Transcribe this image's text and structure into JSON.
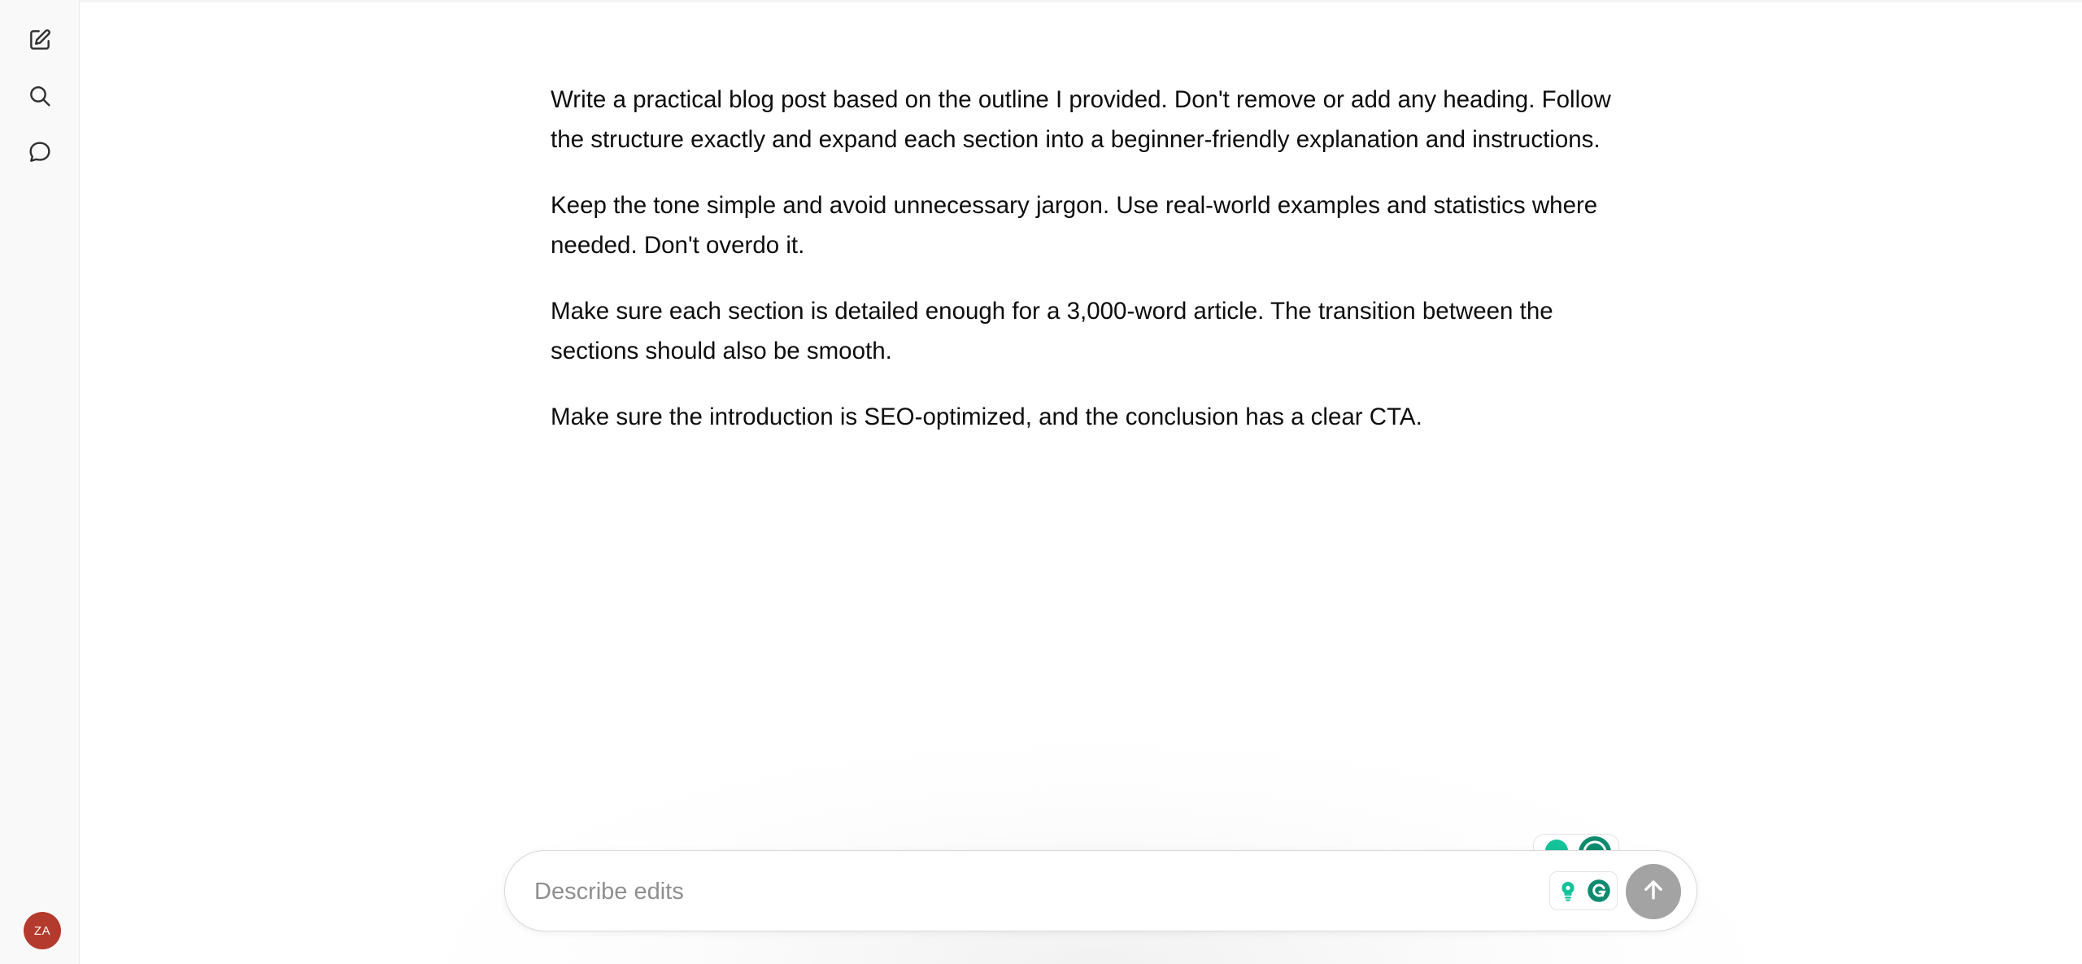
{
  "sidebar": {
    "new_chat_icon": "edit-square-icon",
    "search_icon": "search-icon",
    "chats_icon": "chat-bubble-icon",
    "avatar_initials": "ZA",
    "avatar_color": "#b33a2c"
  },
  "document": {
    "paragraphs": [
      "Write a practical blog post based on the outline I provided. Don't remove or add any heading. Follow the structure exactly and expand each section into a beginner-friendly explanation and instructions.",
      "Keep the tone simple and avoid unnecessary jargon. Use real-world examples and statistics where needed. Don't overdo it.",
      "Make sure each section is detailed enough for a 3,000-word article. The transition between the sections should also be smooth.",
      "Make sure the introduction is SEO-optimized, and the conclusion has a clear CTA."
    ]
  },
  "composer": {
    "placeholder": "Describe edits",
    "value": "",
    "grammarly_lightbulb_icon": "lightbulb-icon",
    "grammarly_logo_icon": "grammarly-g-icon",
    "send_icon": "arrow-up-icon",
    "send_color": "#a3a3a3",
    "grammarly_color": "#15c39a",
    "grammarly_dark": "#0e8b6f"
  }
}
